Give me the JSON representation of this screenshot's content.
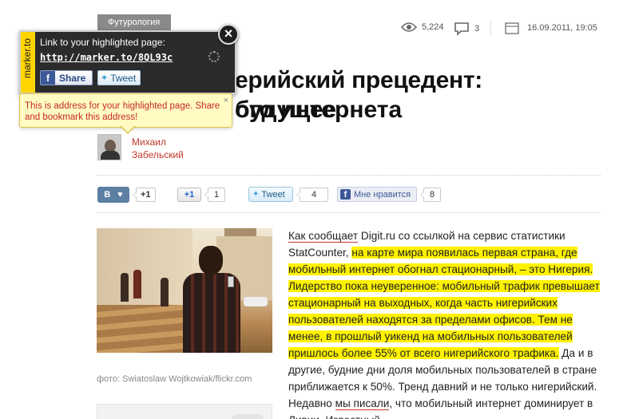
{
  "article": {
    "category": "Футурология",
    "views": "5,224",
    "comments": "3",
    "date": "16.09.2011, 19:05",
    "headline_line1": "ерийский прецедент: будущее",
    "headline_line2": "ого интернета",
    "author_first": "Михаил",
    "author_last": "Забельский",
    "photo_caption": "фото: Swiatoslaw Wojtkowiak/flickr.com",
    "text_link1": "Как сообщает",
    "text_1": " Digit.ru со ссылкой на сервис статистики StatCounter, ",
    "text_hl1": "на карте мира появилась первая страна, где мобильный интернет обогнал стационарный, – это Нигерия. Лидерство пока неуверенное: мобильный трафик превышает стационарный на выходных, когда часть нигерийских пользователей находятся за пределами офисов. Тем не менее, в прошлый уикенд на мобильных пользователей пришлось более 55% от всего нигерийского трафика.",
    "text_2": " Да и в другие, будние дни доля мобильных пользователей в стране приближается к 50%. Тренд давний и не только нигерийский. Недавно ",
    "text_link2": "мы писали",
    "text_3": ", что мобильный интернет доминирует в Ливии. Известный"
  },
  "social": {
    "vk_label": "В",
    "vk_like": "♥",
    "vk_plus": "+1",
    "gplus_label": "+1",
    "gplus_count": "1",
    "tweet_label": "Tweet",
    "tweet_count": "4",
    "fb_label": "Мне нравится",
    "fb_count": "8"
  },
  "popup": {
    "brand": "marker.to",
    "title": "Link to your highlighted page:",
    "url": "http://marker.to/8QL93c",
    "share_label": "Share",
    "tweet_label": "Tweet",
    "close": "×",
    "tooltip": "This is address for your highlighted page. Share and bookmark this address!",
    "tooltip_close": "×"
  },
  "colors": {
    "highlight": "#fff200",
    "brand_yellow": "#ffd500",
    "author_red": "#c0392b"
  }
}
